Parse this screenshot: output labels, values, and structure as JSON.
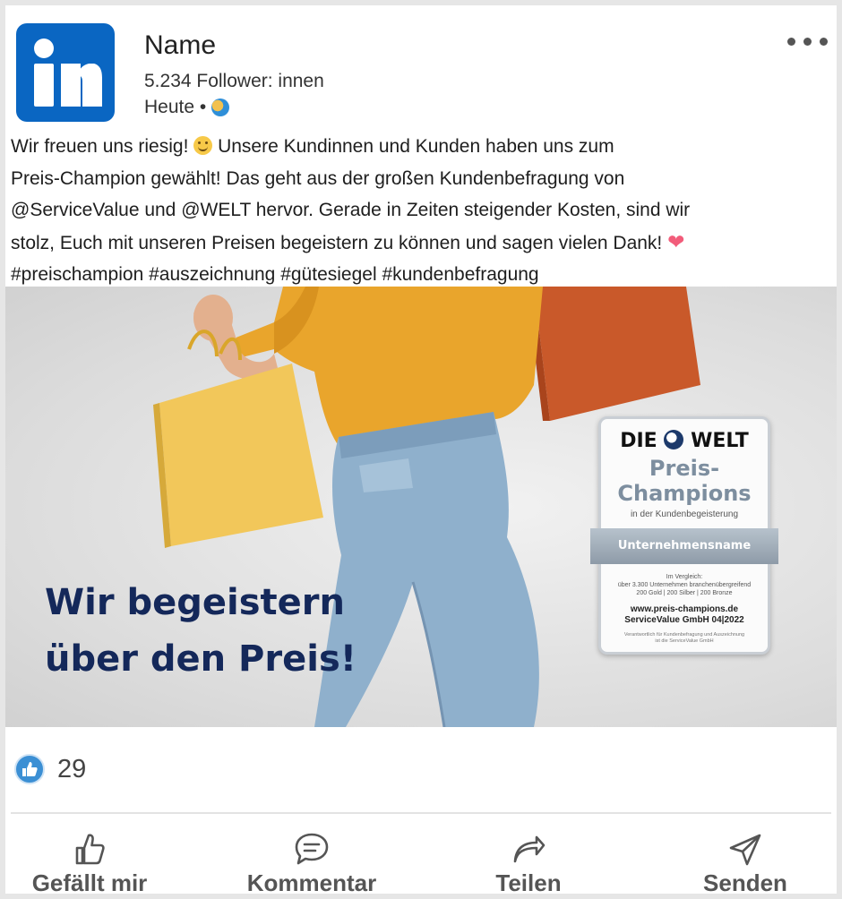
{
  "author": {
    "name": "Name",
    "followers": "5.234 Follower: innen",
    "time": "Heute •"
  },
  "post": {
    "lines": [
      {
        "before": "Wir freuen uns riesig! ",
        "after": "  Unsere Kundinnen und Kunden haben uns zum"
      },
      {
        "text": "Preis-Champion gewählt! Das geht aus der großen Kundenbefragung von"
      },
      {
        "text": "@ServiceValue und @WELT hervor. Gerade in Zeiten steigender Kosten, sind wir"
      },
      {
        "text": "stolz, Euch mit unseren Preisen begeistern zu können und sagen vielen Dank! "
      },
      {
        "text": "#preischampion #auszeichnung #gütesiegel #kundenbefragung"
      }
    ]
  },
  "image": {
    "headline": [
      "Wir begeistern",
      "über den Preis!"
    ],
    "seal": {
      "brand_left": "DIE",
      "brand_right": "WELT",
      "title_1": "Preis-",
      "title_2": "Champions",
      "subtitle": "in der Kundenbegeisterung",
      "company": "Unternehmensname",
      "info_1": "Im Vergleich:",
      "info_2": "über 3.300 Unternehmen branchenübergreifend",
      "info_3": "200 Gold | 200 Silber | 200 Bronze",
      "web": "www.preis-champions.de",
      "issuer": "ServiceValue GmbH   04|2022",
      "fine_1": "Verantwortlich für Kundenbefragung und Auszeichnung",
      "fine_2": "ist die ServiceValue GmbH"
    }
  },
  "reactions": {
    "count": "29"
  },
  "actions": {
    "like": "Gefällt mir",
    "comment": "Kommentar",
    "share": "Teilen",
    "send": "Senden"
  },
  "colors": {
    "brand": "#0a66c2",
    "headline": "#14285a",
    "seal_accent": "#7d8e9f",
    "heart": "#f25c7a",
    "like_badge": "#3b8fd4"
  },
  "icons": [
    "linkedin-logo",
    "globe-icon",
    "more-options-icon",
    "smile-emoji",
    "heart-emoji",
    "like-reaction-icon",
    "thumbs-up-icon",
    "comment-icon",
    "share-arrow-icon",
    "send-icon"
  ]
}
